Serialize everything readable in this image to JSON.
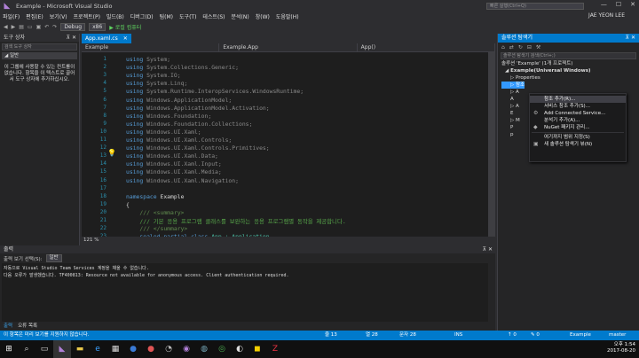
{
  "window": {
    "title": "Example - Microsoft Visual Studio",
    "quick_launch": "빠른 실행(Ctrl+Q)",
    "user": "JAE YEON LEE",
    "logo": "vs-logo-icon"
  },
  "menu": [
    "파일(F)",
    "편집(E)",
    "보기(V)",
    "프로젝트(P)",
    "빌드(B)",
    "디버그(D)",
    "팀(M)",
    "도구(T)",
    "테스트(S)",
    "분석(N)",
    "창(W)",
    "도움말(H)"
  ],
  "toolbar": {
    "config": "Debug",
    "platform": "x86",
    "run": "▶ 로컬 컴퓨터"
  },
  "toolbox": {
    "title": "도구 상자",
    "search": "검색 도구 상자",
    "tab": "◢ 일반",
    "message": "이 그룹에 사용할 수 있는 컨트롤이 없습니다. 항목을 이 텍스트로 끌어서 도구 상자에 추가하십시오."
  },
  "editor": {
    "tab": "App.xaml.cs",
    "nav1": "Example",
    "nav2": "Example.App",
    "nav3": "App()",
    "zoom": "121 %",
    "lines": [
      {
        "n": "1",
        "pre": "",
        "kw": "using",
        "rest": " System;",
        "cls": "gray"
      },
      {
        "n": "2",
        "pre": "",
        "kw": "using",
        "rest": " System.Collections.Generic;",
        "cls": "gray"
      },
      {
        "n": "3",
        "pre": "",
        "kw": "using",
        "rest": " System.IO;",
        "cls": "gray"
      },
      {
        "n": "4",
        "pre": "",
        "kw": "using",
        "rest": " System.Linq;",
        "cls": "gray"
      },
      {
        "n": "5",
        "pre": "",
        "kw": "using",
        "rest": " System.Runtime.InteropServices.WindowsRuntime;",
        "cls": "gray"
      },
      {
        "n": "6",
        "pre": "",
        "kw": "using",
        "rest": " Windows.ApplicationModel;",
        "cls": "gray"
      },
      {
        "n": "7",
        "pre": "",
        "kw": "using",
        "rest": " Windows.ApplicationModel.Activation;",
        "cls": "gray"
      },
      {
        "n": "8",
        "pre": "",
        "kw": "using",
        "rest": " Windows.Foundation;",
        "cls": "gray"
      },
      {
        "n": "9",
        "pre": "",
        "kw": "using",
        "rest": " Windows.Foundation.Collections;",
        "cls": "gray"
      },
      {
        "n": "10",
        "pre": "",
        "kw": "using",
        "rest": " Windows.UI.Xaml;",
        "cls": "gray"
      },
      {
        "n": "11",
        "pre": "",
        "kw": "using",
        "rest": " Windows.UI.Xaml.Controls;",
        "cls": "gray"
      },
      {
        "n": "12",
        "pre": "",
        "kw": "using",
        "rest": " Windows.UI.Xaml.Controls.Primitives;",
        "cls": "gray"
      },
      {
        "n": "13",
        "pre": "",
        "kw": "using",
        "rest": " Windows.UI.Xaml.Data;",
        "cls": "gray"
      },
      {
        "n": "14",
        "pre": "",
        "kw": "using",
        "rest": " Windows.UI.Xaml.Input;",
        "cls": "gray"
      },
      {
        "n": "15",
        "pre": "",
        "kw": "using",
        "rest": " Windows.UI.Xaml.Media;",
        "cls": "gray"
      },
      {
        "n": "16",
        "pre": "",
        "kw": "using",
        "rest": " Windows.UI.Xaml.Navigation;",
        "cls": "gray"
      },
      {
        "n": "17",
        "pre": "",
        "kw": "",
        "rest": "",
        "cls": "gray"
      },
      {
        "n": "18",
        "pre": "",
        "kw": "namespace",
        "rest": " Example",
        "cls": ""
      },
      {
        "n": "19",
        "pre": "",
        "kw": "",
        "rest": "{",
        "cls": ""
      },
      {
        "n": "20",
        "pre": "    ",
        "kw": "",
        "rest": "/// <summary>",
        "cls": "dk"
      },
      {
        "n": "21",
        "pre": "    ",
        "kw": "",
        "rest": "/// 기본 응용 프로그램 클래스를 보완하는 응용 프로그램별 동작을 제공합니다.",
        "cls": "cm"
      },
      {
        "n": "22",
        "pre": "    ",
        "kw": "",
        "rest": "/// </summary>",
        "cls": "dk"
      },
      {
        "n": "23",
        "pre": "    ",
        "kw": "sealed partial class",
        "rest": " App : Application",
        "cls": "tp"
      }
    ]
  },
  "output": {
    "title": "출력",
    "source_label": "출력 보기 선택(S):",
    "source": "일반",
    "lines": [
      "자동으로 Visual Studio Team Services 계정을 채울 수 없습니다.",
      "",
      "다음 오류가 발생했습니다. TF400813: Resource not available for anonymous access. Client authentication required."
    ],
    "tabs": [
      "출력",
      "오류 목록"
    ]
  },
  "solution": {
    "title": "솔루션 탐색기",
    "search": "솔루션 탐색기 검색(Ctrl+;)",
    "nodes": [
      "솔루션 'Example' (1개 프로젝트)",
      "◢ Example(Universal Windows)",
      "▷ Properties",
      "▷ 참조",
      "▷ A",
      "  A",
      "▷ A",
      "  E",
      "▷ M",
      "  P",
      "  p"
    ]
  },
  "context_menu": {
    "items": [
      {
        "label": "참조 추가(R)...",
        "icon": ""
      },
      {
        "label": "서비스 참조 추가(S)...",
        "icon": ""
      },
      {
        "label": "Add Connected Service...",
        "icon": "⚙"
      },
      {
        "label": "분석기 추가(A)...",
        "icon": ""
      },
      {
        "label": "NuGet 패키지 관리...",
        "icon": "◆"
      },
      {
        "label": "sep"
      },
      {
        "label": "여기까지 범위 지정(S)",
        "icon": ""
      },
      {
        "label": "새 솔루션 탐색기 뷰(N)",
        "icon": "▣"
      }
    ]
  },
  "status": {
    "left": "이 항목은 미리 보기를 지원하지 않습니다.",
    "line": "줄 13",
    "col": "열 28",
    "char": "문자 28",
    "mode": "INS",
    "up": "↑ 0",
    "edit": "✎ 0",
    "project": "Example",
    "branch": "master"
  },
  "clock": {
    "time": "오후 1:54",
    "date": "2017-08-20"
  },
  "colors": {
    "accent": "#007acc",
    "bg": "#2d2d30",
    "editor": "#1e1e1e"
  }
}
